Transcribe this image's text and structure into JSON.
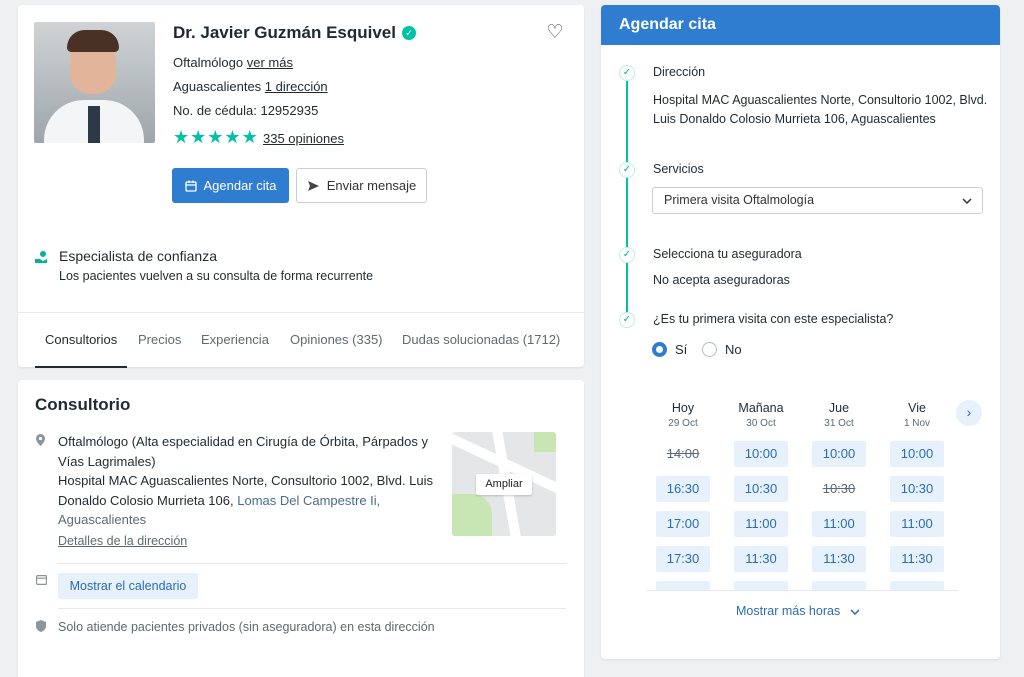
{
  "profile": {
    "name": "Dr. Javier Guzmán Esquivel",
    "specialty": "Oftalmólogo",
    "see_more": "ver más",
    "city": "Aguascalientes",
    "addresses_link": "1 dirección",
    "license_label": "No. de cédula:",
    "license_number": "12952935",
    "rating_stars": 5,
    "reviews_link": "335 opiniones",
    "book_button": "Agendar cita",
    "message_button": "Enviar mensaje",
    "trust_title": "Especialista de confianza",
    "trust_subtitle": "Los pacientes vuelven a su consulta de forma recurrente",
    "tabs": [
      "Consultorios",
      "Precios",
      "Experiencia",
      "Opiniones (335)",
      "Dudas solucionadas (1712)"
    ],
    "active_tab": "Consultorios"
  },
  "office": {
    "title": "Consultorio",
    "specialty_line": "Oftalmólogo (Alta especialidad en Cirugía de Órbita, Párpados y Vías Lagrimales)",
    "address_main": "Hospital MAC Aguascalientes Norte, Consultorio 1002, Blvd. Luis Donaldo Colosio Murrieta 106,",
    "address_neighborhood": "Lomas Del Campestre Ii,",
    "address_city": "Aguascalientes",
    "details_link": "Detalles de la dirección",
    "map_button": "Ampliar",
    "show_calendar": "Mostrar el calendario",
    "insurance_note": "Solo atiende pacientes privados (sin aseguradora) en esta dirección"
  },
  "booking": {
    "title": "Agendar cita",
    "address_label": "Dirección",
    "address_value": "Hospital MAC Aguascalientes Norte, Consultorio 1002, Blvd. Luis Donaldo Colosio Murrieta 106, Aguascalientes",
    "services_label": "Servicios",
    "service_selected": "Primera visita Oftalmología",
    "insurer_label": "Selecciona tu aseguradora",
    "insurer_value": "No acepta aseguradoras",
    "first_visit_label": "¿Es tu primera visita con este especialista?",
    "option_yes": "Sí",
    "option_no": "No",
    "selected_option": "Sí",
    "days": [
      {
        "name": "Hoy",
        "date": "29 Oct"
      },
      {
        "name": "Mañana",
        "date": "30 Oct"
      },
      {
        "name": "Jue",
        "date": "31 Oct"
      },
      {
        "name": "Vie",
        "date": "1 Nov"
      }
    ],
    "slots": [
      [
        {
          "t": "14:00",
          "unavailable": true
        },
        {
          "t": "16:30"
        },
        {
          "t": "17:00"
        },
        {
          "t": "17:30"
        },
        {
          "t": ""
        }
      ],
      [
        {
          "t": "10:00"
        },
        {
          "t": "10:30"
        },
        {
          "t": "11:00"
        },
        {
          "t": "11:30"
        },
        {
          "t": ""
        }
      ],
      [
        {
          "t": "10:00"
        },
        {
          "t": "10:30",
          "unavailable": true
        },
        {
          "t": "11:00"
        },
        {
          "t": "11:30"
        },
        {
          "t": ""
        }
      ],
      [
        {
          "t": "10:00"
        },
        {
          "t": "10:30"
        },
        {
          "t": "11:00"
        },
        {
          "t": "11:30"
        },
        {
          "t": ""
        }
      ]
    ],
    "show_more": "Mostrar más horas"
  },
  "colors": {
    "primary": "#2f7dd1",
    "accent": "#00c3a5",
    "slot_bg": "#e6f1fb"
  },
  "icons": [
    "verified-icon",
    "heart-icon",
    "star-icon",
    "calendar-icon",
    "send-icon",
    "trust-hand-icon",
    "map-pin-icon",
    "shield-icon",
    "check-icon",
    "chevron-down-icon",
    "chevron-right-icon"
  ]
}
